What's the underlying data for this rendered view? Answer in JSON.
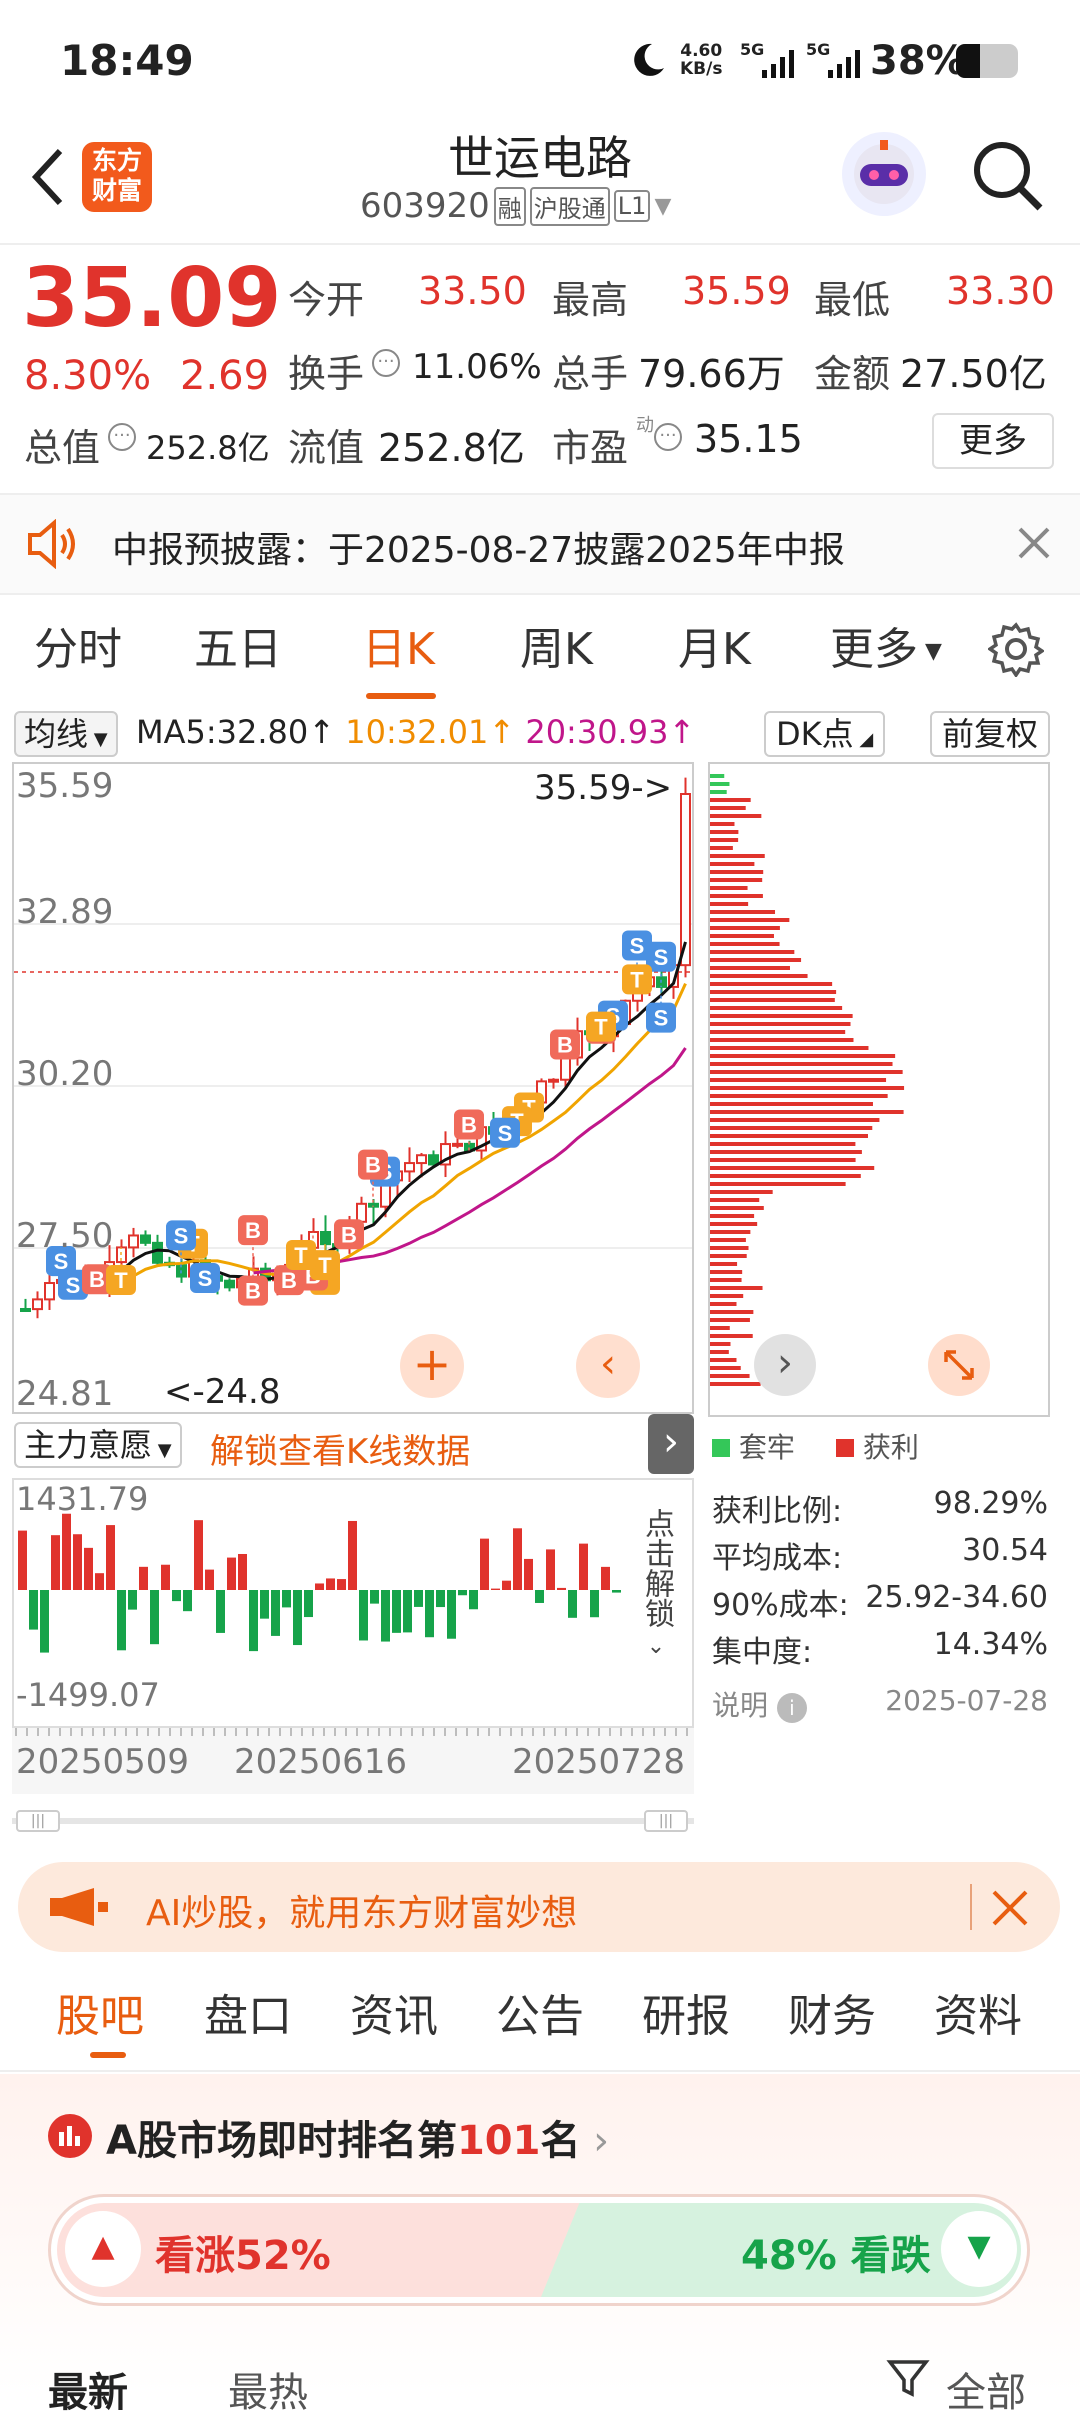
{
  "status_bar": {
    "time": "18:49",
    "net_speed_top": "4.60",
    "net_speed_unit": "KB/s",
    "signal1": "5G",
    "signal2": "5G",
    "battery": "38%"
  },
  "header": {
    "logo_line1": "东方",
    "logo_line2": "财富",
    "name": "世运电路",
    "code": "603920",
    "tags": [
      "融",
      "沪股通",
      "L1"
    ]
  },
  "quote": {
    "price": "35.09",
    "change_pct": "8.30%",
    "change": "2.69",
    "open_label": "今开",
    "open": "33.50",
    "high_label": "最高",
    "high": "35.59",
    "low_label": "最低",
    "low": "33.30",
    "turnover_label": "换手",
    "turnover": "11.06%",
    "volume_label": "总手",
    "volume": "79.66万",
    "amount_label": "金额",
    "amount": "27.50亿",
    "mktcap_label": "总值",
    "mktcap": "252.8亿",
    "float_label": "流值",
    "float": "252.8亿",
    "pe_label": "市盈",
    "pe_sup": "动",
    "pe": "35.15",
    "more": "更多"
  },
  "notice": {
    "text": "中报预披露：于2025-08-27披露2025年中报"
  },
  "chart_tabs": [
    "分时",
    "五日",
    "日K",
    "周K",
    "月K",
    "更多"
  ],
  "chart_tabs_active": 2,
  "chart_bar": {
    "ma_select": "均线",
    "ma5": "MA5:32.80",
    "ma10": "10:32.01",
    "ma20": "20:30.93",
    "arrow": "↑",
    "dk": "DK点",
    "adjust": "前复权"
  },
  "kline": {
    "y_labels": [
      "35.59",
      "32.89",
      "30.20",
      "27.50",
      "24.81"
    ],
    "high_annot": "35.59->",
    "low_annot": "<-24.8",
    "indicator_select": "主力意愿",
    "unlock_text": "解锁查看K线数据",
    "flow_max": "1431.79",
    "flow_min": "-1499.07",
    "dates": [
      "20250509",
      "20250616",
      "20250728"
    ],
    "unlock_side": "点击解锁"
  },
  "chip": {
    "legend_trapped": "套牢",
    "legend_profit": "获利",
    "rows": [
      {
        "label": "获利比例:",
        "value": "98.29%"
      },
      {
        "label": "平均成本:",
        "value": "30.54"
      },
      {
        "label": "90%成本:",
        "value": "25.92-34.60"
      },
      {
        "label": "集中度:",
        "value": "14.34%"
      }
    ],
    "note": "说明",
    "date": "2025-07-28"
  },
  "ai_banner": {
    "text": "AI炒股，就用东方财富妙想"
  },
  "sections": [
    "股吧",
    "盘口",
    "资讯",
    "公告",
    "研报",
    "财务",
    "资料"
  ],
  "sections_active": 0,
  "rank": {
    "prefix": "A股市场即时排名第",
    "num": "101",
    "suffix": "名"
  },
  "vote": {
    "up": "看涨52%",
    "down": "48% 看跌"
  },
  "bottom": {
    "left1": "最新",
    "left2": "最热",
    "right": "全部"
  },
  "colors": {
    "up": "#e0332c",
    "down": "#16a34a",
    "ma10": "#f0a400",
    "ma20": "#c0168a",
    "accent": "#e85d10"
  }
}
